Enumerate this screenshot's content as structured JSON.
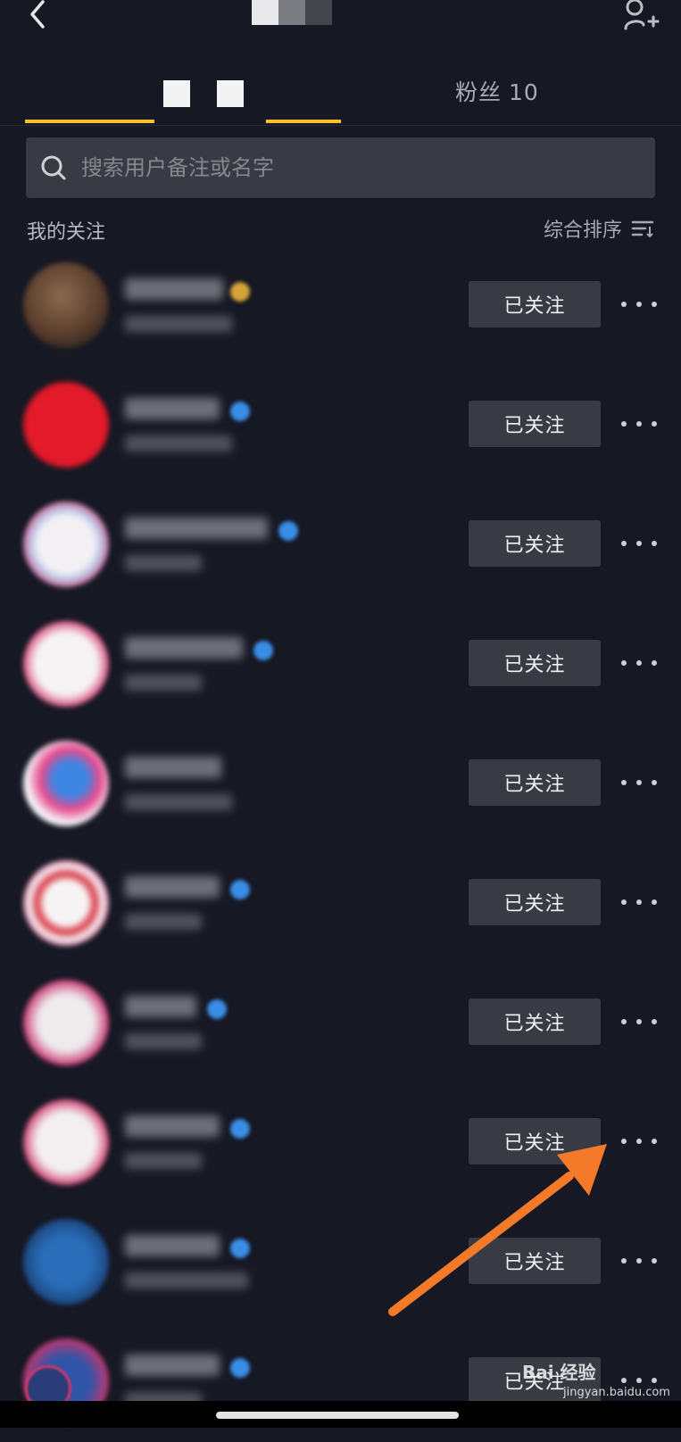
{
  "tabs": {
    "fans_label": "粉丝",
    "fans_count": "10"
  },
  "search": {
    "placeholder": "搜索用户备注或名字"
  },
  "section": {
    "title": "我的关注",
    "sort_label": "综合排序"
  },
  "follow_button_label": "已关注",
  "watermark": {
    "brand": "Bai 经验",
    "url": "jingyan.baidu.com"
  },
  "colors": {
    "background": "#161823",
    "accent": "#f9c02b",
    "button_bg": "#393b44",
    "annotation_arrow": "#f47a2a",
    "verified_badge": "#3a8ee6"
  },
  "icons": [
    "back-icon",
    "add-friend-icon",
    "search-icon",
    "sort-icon",
    "more-icon"
  ]
}
